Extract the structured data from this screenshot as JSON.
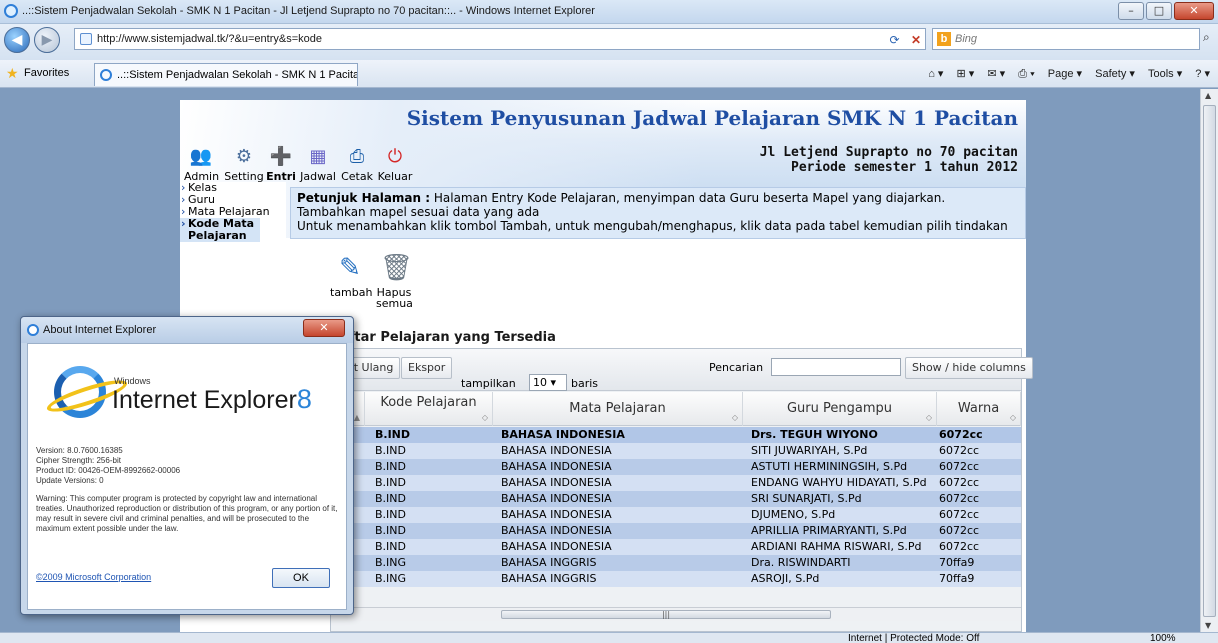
{
  "window": {
    "title": "..::Sistem Penjadwalan Sekolah - SMK N 1 Pacitan - Jl Letjend Suprapto no 70 pacitan::.. - Windows Internet Explorer",
    "minimize": "–",
    "maximize": "□",
    "close": "✕"
  },
  "address_bar": {
    "url": "http://www.sistemjadwal.tk/?&u=entry&s=kode",
    "back": "◀",
    "forward": "▶",
    "refresh": "⟳",
    "stop": "✕",
    "search_placeholder": "Bing",
    "search_icon": "⌕"
  },
  "favorites_bar": {
    "favorites_label": "Favorites",
    "tab_label": "..::Sistem Penjadwalan Sekolah - SMK N 1 Pacitan...",
    "home": "⌂ ▾",
    "feeds": "⊞ ▾",
    "mail": "✉ ▾",
    "print": "⎙ ▾",
    "page_menu": "Page ▾",
    "safety_menu": "Safety ▾",
    "tools_menu": "Tools ▾",
    "help_menu": "? ▾"
  },
  "site": {
    "title": "Sistem Penyusunan Jadwal Pelajaran SMK N 1 Pacitan",
    "address_line1": "Jl Letjend Suprapto no 70 pacitan",
    "address_line2": "Periode semester 1 tahun 2012",
    "toolbar": [
      {
        "label": "Admin",
        "icon": "users-icon",
        "glyph": "👥"
      },
      {
        "label": "Setting",
        "icon": "gear-icon",
        "glyph": "⚙"
      },
      {
        "label": "Entri",
        "icon": "add-icon",
        "glyph": "➕"
      },
      {
        "label": "Jadwal",
        "icon": "calendar-icon",
        "glyph": "▦"
      },
      {
        "label": "Cetak",
        "icon": "printer-icon",
        "glyph": "⎙"
      },
      {
        "label": "Keluar",
        "icon": "power-icon",
        "glyph": "⏻"
      }
    ],
    "side_menu": [
      "Kelas",
      "Guru",
      "Mata Pelajaran",
      "Kode Mata Pelajaran"
    ],
    "hint_label": "Petunjuk Halaman :",
    "hint_text1": " Halaman Entry Kode Pelajaran, menyimpan data Guru beserta Mapel yang diajarkan.",
    "hint_text2": "Tambahkan mapel sesuai data yang ada",
    "hint_text3": "Untuk menambahkan klik tombol Tambah, untuk mengubah/menghapus, klik data pada tabel kemudian pilih tindakan",
    "action_add": "tambah",
    "action_delete_1": "Hapus",
    "action_delete_2": "semua",
    "section_title": "aftar Pelajaran yang Tersedia"
  },
  "table": {
    "btn_reload": "uat Ulang",
    "btn_export": "Ekspor",
    "search_label": "Pencarian",
    "show_hide": "Show / hide columns",
    "show_prefix": "tampilkan",
    "show_value": "10",
    "show_suffix": "baris",
    "headers": {
      "no": "o",
      "kode": "Kode Pelajaran",
      "mapel": "Mata Pelajaran",
      "guru": "Guru Pengampu",
      "warna": "Warna"
    },
    "rows": [
      {
        "kode": "B.IND",
        "mapel": "BAHASA INDONESIA",
        "guru": "Drs. TEGUH WIYONO",
        "warna": "6072cc"
      },
      {
        "kode": "B.IND",
        "mapel": "BAHASA INDONESIA",
        "guru": "SITI JUWARIYAH, S.Pd",
        "warna": "6072cc"
      },
      {
        "kode": "B.IND",
        "mapel": "BAHASA INDONESIA",
        "guru": "ASTUTI HERMININGSIH, S.Pd",
        "warna": "6072cc"
      },
      {
        "kode": "B.IND",
        "mapel": "BAHASA INDONESIA",
        "guru": "ENDANG WAHYU HIDAYATI, S.Pd",
        "warna": "6072cc"
      },
      {
        "kode": "B.IND",
        "mapel": "BAHASA INDONESIA",
        "guru": "SRI SUNARJATI, S.Pd",
        "warna": "6072cc"
      },
      {
        "kode": "B.IND",
        "mapel": "BAHASA INDONESIA",
        "guru": "DJUMENO, S.Pd",
        "warna": "6072cc"
      },
      {
        "kode": "B.IND",
        "mapel": "BAHASA INDONESIA",
        "guru": "APRILLIA PRIMARYANTI, S.Pd",
        "warna": "6072cc"
      },
      {
        "kode": "B.IND",
        "mapel": "BAHASA INDONESIA",
        "guru": "ARDIANI RAHMA RISWARI, S.Pd",
        "warna": "6072cc"
      },
      {
        "kode": "B.ING",
        "mapel": "BAHASA INGGRIS",
        "guru": "Dra. RISWINDARTI",
        "warna": "70ffa9"
      },
      {
        "kode": "B.ING",
        "mapel": "BAHASA INGGRIS",
        "guru": "ASROJI, S.Pd",
        "warna": "70ffa9"
      }
    ]
  },
  "about_dialog": {
    "title": "About Internet Explorer",
    "close": "✕",
    "logo_windows": "Windows",
    "logo_product": "Internet Explorer",
    "logo_version": "8",
    "version": "Version: 8.0.7600.16385",
    "cipher": "Cipher Strength: 256-bit",
    "product_id": "Product ID: 00426-OEM-8992662-00006",
    "update": "Update Versions: 0",
    "warning": "Warning: This computer program is protected by copyright law and international treaties. Unauthorized reproduction or distribution of this program, or any portion of it, may result in severe civil and criminal penalties, and will be prosecuted to the maximum extent possible under the law.",
    "copyright_link": "©2009 Microsoft Corporation",
    "ok": "OK"
  },
  "status_bar": {
    "zone": "Internet | Protected Mode: Off",
    "zoom": "100%"
  }
}
